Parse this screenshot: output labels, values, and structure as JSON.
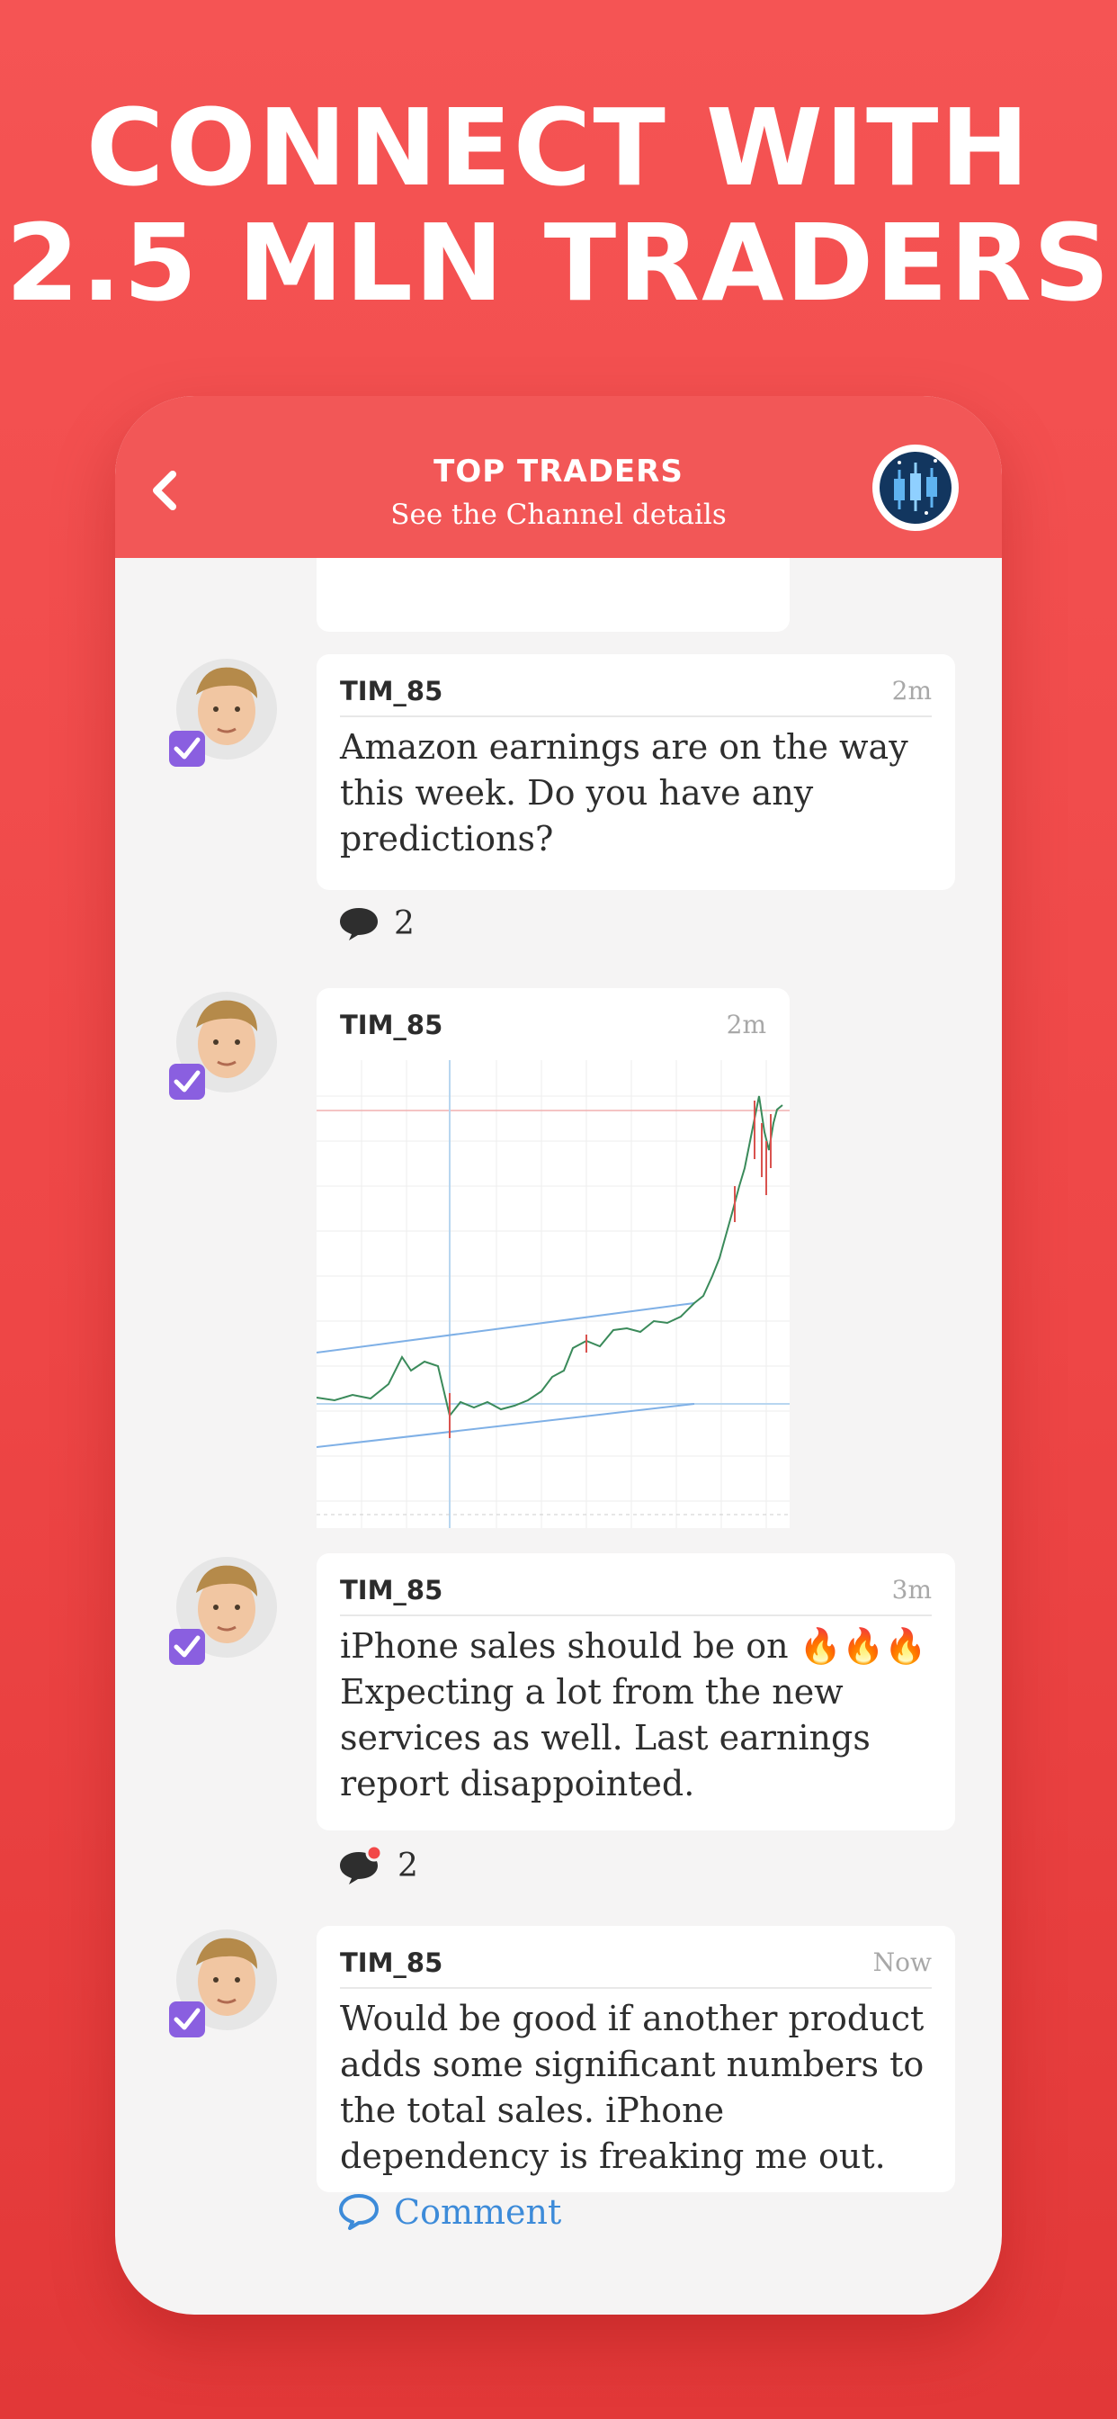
{
  "headline": {
    "line1": "CONNECT WITH",
    "line2": "2.5 MLN TRADERS"
  },
  "channel": {
    "title": "TOP TRADERS",
    "subtitle": "See the Channel details"
  },
  "posts": [
    {
      "author": "TIM_85",
      "time": "2m",
      "text": "Amazon earnings are on the way this week. Do you have any predictions?",
      "replies": "2"
    },
    {
      "author": "TIM_85",
      "time": "2m",
      "attachment": "price-chart-image"
    },
    {
      "author": "TIM_85",
      "time": "3m",
      "text": "iPhone sales should be on 🔥🔥🔥 Expecting a lot from the new services as well. Last earnings report disappointed.",
      "replies": "2",
      "unread": true
    },
    {
      "author": "TIM_85",
      "time": "Now",
      "text": "Would be good if another product adds some significant numbers to the total sales. iPhone dependency is freaking me out."
    }
  ],
  "comment_label": "Comment",
  "colors": {
    "brand": "#f25757",
    "verified": "#8a5fe0",
    "link": "#3d8bd9",
    "unread": "#f24848"
  },
  "icons": [
    "back-chevron-icon",
    "channel-candlestick-icon",
    "verified-badge-icon",
    "chat-bubble-icon",
    "comment-icon"
  ]
}
